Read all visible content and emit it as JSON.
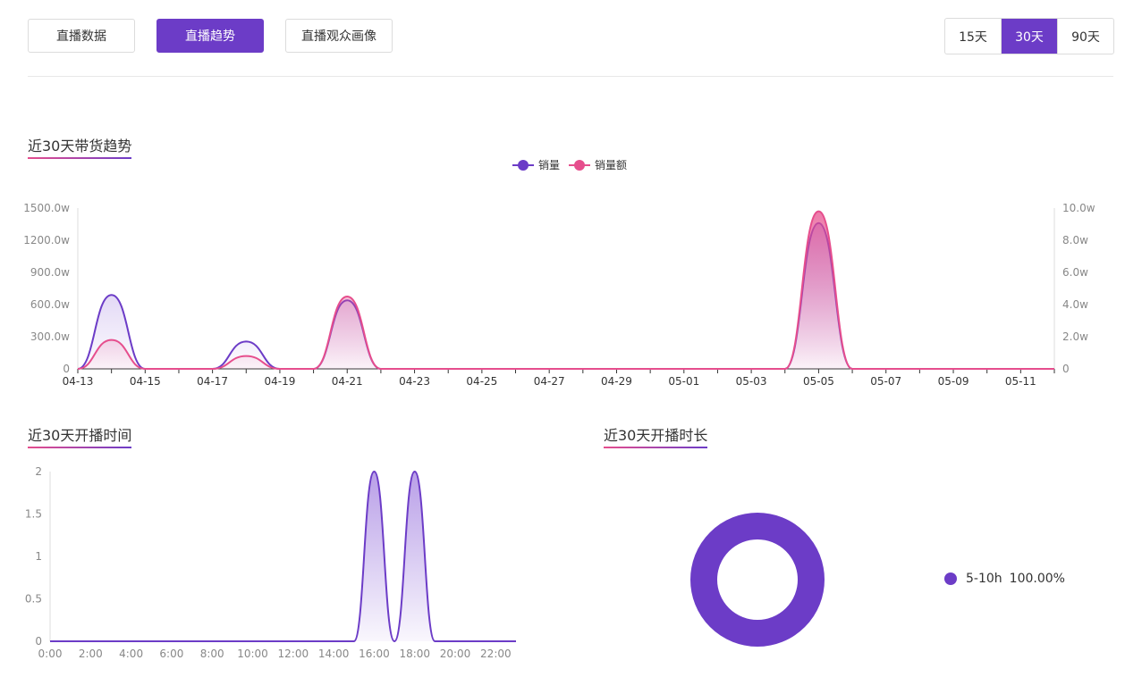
{
  "tabs": [
    {
      "label": "直播数据",
      "active": false
    },
    {
      "label": "直播趋势",
      "active": true
    },
    {
      "label": "直播观众画像",
      "active": false
    }
  ],
  "range": {
    "options": [
      "15天",
      "30天",
      "90天"
    ],
    "selected": "30天"
  },
  "colors": {
    "accent": "#6c3cc7",
    "pink": "#e64e8d"
  },
  "sales_trend": {
    "title": "近30天带货趋势",
    "legend": [
      "销量",
      "销量额"
    ]
  },
  "broadcast_time": {
    "title": "近30天开播时间"
  },
  "broadcast_duration": {
    "title": "近30天开播时长",
    "legend_label": "5-10h",
    "legend_value": "100.00%"
  },
  "chart_data": [
    {
      "type": "area",
      "title": "近30天带货趋势",
      "x": [
        "04-13",
        "04-14",
        "04-15",
        "04-16",
        "04-17",
        "04-18",
        "04-19",
        "04-20",
        "04-21",
        "04-22",
        "04-23",
        "04-24",
        "04-25",
        "04-26",
        "04-27",
        "04-28",
        "04-29",
        "04-30",
        "05-01",
        "05-02",
        "05-03",
        "05-04",
        "05-05",
        "05-06",
        "05-07",
        "05-08",
        "05-09",
        "05-10",
        "05-11",
        "05-12"
      ],
      "x_tick_labels": [
        "04-13",
        "04-15",
        "04-17",
        "04-19",
        "04-21",
        "04-23",
        "04-25",
        "04-27",
        "04-29",
        "05-01",
        "05-03",
        "05-05",
        "05-07",
        "05-09",
        "05-11"
      ],
      "y_left": {
        "ticks": [
          "0",
          "300.0w",
          "600.0w",
          "900.0w",
          "1200.0w",
          "1500.0w"
        ],
        "ylim": [
          0,
          1500
        ]
      },
      "y_right": {
        "ticks": [
          "0",
          "2.0w",
          "4.0w",
          "6.0w",
          "8.0w",
          "10.0w"
        ],
        "ylim": [
          0,
          10
        ]
      },
      "series": [
        {
          "name": "销量",
          "axis": "left",
          "color": "#6c3cc7",
          "values": [
            0,
            690,
            0,
            0,
            0,
            255,
            0,
            0,
            640,
            0,
            0,
            0,
            0,
            0,
            0,
            0,
            0,
            0,
            0,
            0,
            0,
            0,
            1360,
            0,
            0,
            0,
            0,
            0,
            0,
            0
          ]
        },
        {
          "name": "销量额",
          "axis": "right",
          "color": "#e64e8d",
          "values": [
            0,
            1.8,
            0,
            0,
            0,
            0.8,
            0,
            0,
            4.5,
            0,
            0,
            0,
            0,
            0,
            0,
            0,
            0,
            0,
            0,
            0,
            0,
            0,
            9.8,
            0,
            0,
            0,
            0,
            0,
            0,
            0
          ]
        }
      ]
    },
    {
      "type": "area",
      "title": "近30天开播时间",
      "x": [
        "0:00",
        "1:00",
        "2:00",
        "3:00",
        "4:00",
        "5:00",
        "6:00",
        "7:00",
        "8:00",
        "9:00",
        "10:00",
        "11:00",
        "12:00",
        "13:00",
        "14:00",
        "15:00",
        "16:00",
        "17:00",
        "18:00",
        "19:00",
        "20:00",
        "21:00",
        "22:00",
        "23:00"
      ],
      "x_tick_labels": [
        "0:00",
        "2:00",
        "4:00",
        "6:00",
        "8:00",
        "10:00",
        "12:00",
        "14:00",
        "16:00",
        "18:00",
        "20:00",
        "22:00"
      ],
      "y_ticks": [
        "0",
        "0.5",
        "1",
        "1.5",
        "2"
      ],
      "ylim": [
        0,
        2
      ],
      "series": [
        {
          "color": "#6c3cc7",
          "values": [
            0,
            0,
            0,
            0,
            0,
            0,
            0,
            0,
            0,
            0,
            0,
            0,
            0,
            0,
            0,
            0,
            2,
            0,
            2,
            0,
            0,
            0,
            0,
            0
          ]
        }
      ]
    },
    {
      "type": "pie",
      "title": "近30天开播时长",
      "labels": [
        "5-10h"
      ],
      "values": [
        100.0
      ],
      "colors": [
        "#6c3cc7"
      ]
    }
  ]
}
